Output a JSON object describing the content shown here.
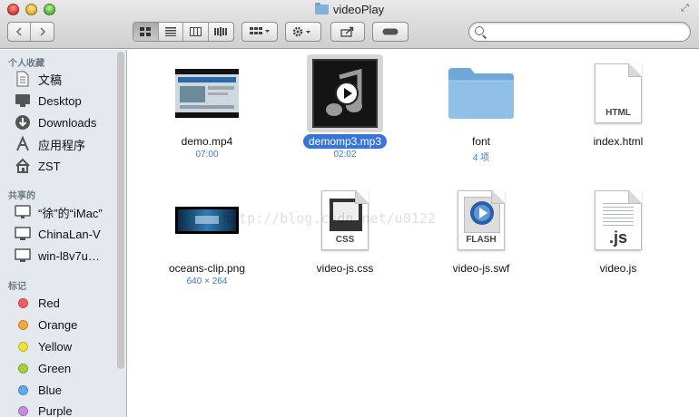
{
  "window": {
    "title": "videoPlay"
  },
  "sidebar": {
    "sections": [
      {
        "heading": "个人收藏",
        "items": [
          {
            "label": "文稿",
            "icon": "document-icon"
          },
          {
            "label": "Desktop",
            "icon": "desktop-icon"
          },
          {
            "label": "Downloads",
            "icon": "download-icon"
          },
          {
            "label": "应用程序",
            "icon": "applications-icon"
          },
          {
            "label": "ZST",
            "icon": "home-icon"
          }
        ]
      },
      {
        "heading": "共享的",
        "items": [
          {
            "label": "“徐”的“iMac”",
            "icon": "imac-icon"
          },
          {
            "label": "ChinaLan-V",
            "icon": "monitor-icon"
          },
          {
            "label": "win-l8v7u…",
            "icon": "monitor-icon"
          }
        ]
      },
      {
        "heading": "标记",
        "items": [
          {
            "label": "Red",
            "color": "#f25c5c"
          },
          {
            "label": "Orange",
            "color": "#f5a83a"
          },
          {
            "label": "Yellow",
            "color": "#f0e23a"
          },
          {
            "label": "Green",
            "color": "#a6d13c"
          },
          {
            "label": "Blue",
            "color": "#63a8ec"
          },
          {
            "label": "Purple",
            "color": "#c98be0"
          }
        ]
      }
    ]
  },
  "files": [
    {
      "name": "demo.mp4",
      "meta": "07:00",
      "kind": "video"
    },
    {
      "name": "demomp3.mp3",
      "meta": "02:02",
      "kind": "audio",
      "selected": true
    },
    {
      "name": "font",
      "meta": "4 项",
      "kind": "folder"
    },
    {
      "name": "index.html",
      "meta": "",
      "kind": "html",
      "badge": "HTML"
    },
    {
      "name": "oceans-clip.png",
      "meta": "640 × 264",
      "kind": "image"
    },
    {
      "name": "video-js.css",
      "meta": "",
      "kind": "css",
      "badge": "CSS"
    },
    {
      "name": "video-js.swf",
      "meta": "",
      "kind": "swf",
      "badge": "FLASH"
    },
    {
      "name": "video.js",
      "meta": "",
      "kind": "js",
      "badge": ".js"
    }
  ],
  "watermark": "http://blog.csdn.net/u0122"
}
